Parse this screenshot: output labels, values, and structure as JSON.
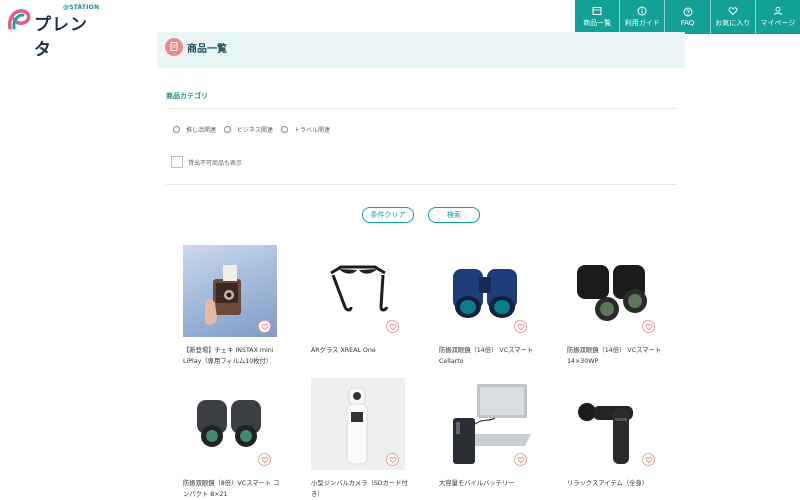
{
  "brand": {
    "station_label": "@STATION",
    "name": "プレンタ",
    "accent": "#13a096"
  },
  "nav": [
    {
      "label": "商品一覧",
      "icon": "list-icon"
    },
    {
      "label": "利用ガイド",
      "icon": "info-icon"
    },
    {
      "label": "FAQ",
      "icon": "question-icon"
    },
    {
      "label": "お気に入り",
      "icon": "heart-icon"
    },
    {
      "label": "マイページ",
      "icon": "user-icon"
    }
  ],
  "page": {
    "title": "商品一覧"
  },
  "filters": {
    "section_label": "商品カテゴリ",
    "categories": [
      "推し活関連",
      "ビジネス関連",
      "トラベル関連"
    ],
    "show_unavailable_label": "貸出不可商品も表示",
    "clear_label": "条件クリア",
    "search_label": "検索"
  },
  "products": [
    {
      "name": "【新登場】チェキ INSTAX mini LiPlay（専用フィルム10枚付）",
      "image": "instax-camera-photo"
    },
    {
      "name": "ARグラス XREAL One",
      "image": "ar-glasses-photo"
    },
    {
      "name": "防振双眼鏡（14倍） VCスマートCellarto",
      "image": "blue-binoculars-photo"
    },
    {
      "name": "防振双眼鏡（14倍） VCスマート 14×30WP",
      "image": "black-binoculars-photo"
    },
    {
      "name": "防振双眼鏡（8倍）VCスマート コンパクト 8×21",
      "image": "compact-binoculars-photo"
    },
    {
      "name": "小型ジンバルカメラ（SDカード付き）",
      "image": "gimbal-camera-photo"
    },
    {
      "name": "大容量モバイルバッテリー",
      "image": "mobile-battery-photo"
    },
    {
      "name": "リラックスアイテム（全身）",
      "image": "massage-gun-photo"
    }
  ]
}
